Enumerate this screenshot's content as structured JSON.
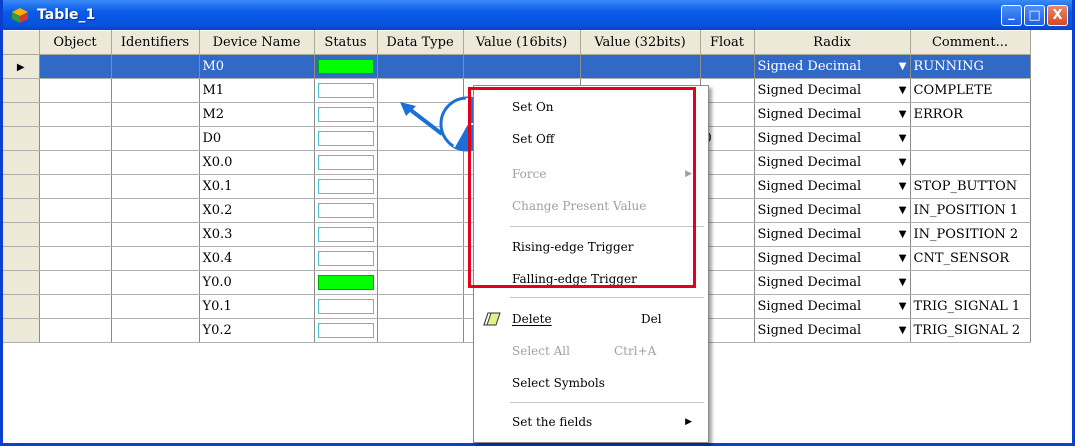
{
  "window": {
    "title": "Table_1",
    "minimize": "_",
    "maximize": "□",
    "close": "X"
  },
  "columns": [
    "Object",
    "Identifiers",
    "Device Name",
    "Status",
    "Data Type",
    "Value (16bits)",
    "Value (32bits)",
    "Float",
    "Radix",
    "Comment..."
  ],
  "rows": [
    {
      "device": "M0",
      "status_on": true,
      "float": "",
      "radix": "Signed Decimal",
      "comment": "RUNNING",
      "selected": true
    },
    {
      "device": "M1",
      "status_on": false,
      "float": "",
      "radix": "Signed Decimal",
      "comment": "COMPLETE"
    },
    {
      "device": "M2",
      "status_on": false,
      "float": "",
      "radix": "Signed Decimal",
      "comment": "ERROR"
    },
    {
      "device": "D0",
      "status_on": false,
      "float": "0",
      "radix": "Signed Decimal",
      "comment": ""
    },
    {
      "device": "X0.0",
      "status_on": false,
      "float": "",
      "radix": "Signed Decimal",
      "comment": ""
    },
    {
      "device": "X0.1",
      "status_on": false,
      "float": "",
      "radix": "Signed Decimal",
      "comment": "STOP_BUTTON"
    },
    {
      "device": "X0.2",
      "status_on": false,
      "float": "",
      "radix": "Signed Decimal",
      "comment": "IN_POSITION 1"
    },
    {
      "device": "X0.3",
      "status_on": false,
      "float": "",
      "radix": "Signed Decimal",
      "comment": "IN_POSITION 2"
    },
    {
      "device": "X0.4",
      "status_on": false,
      "float": "",
      "radix": "Signed Decimal",
      "comment": "CNT_SENSOR"
    },
    {
      "device": "Y0.0",
      "status_on": true,
      "float": "",
      "radix": "Signed Decimal",
      "comment": ""
    },
    {
      "device": "Y0.1",
      "status_on": false,
      "float": "",
      "radix": "Signed Decimal",
      "comment": "TRIG_SIGNAL 1"
    },
    {
      "device": "Y0.2",
      "status_on": false,
      "float": "",
      "radix": "Signed Decimal",
      "comment": "TRIG_SIGNAL 2"
    }
  ],
  "context_menu": {
    "set_on": "Set On",
    "set_off": "Set Off",
    "force": "Force",
    "change_present_value": "Change Present Value",
    "rising_edge": "Rising-edge Trigger",
    "falling_edge": "Falling-edge Trigger",
    "delete": "Delete",
    "delete_shortcut": "Del",
    "select_all": "Select All",
    "select_all_shortcut": "Ctrl+A",
    "select_symbols": "Select Symbols",
    "set_fields": "Set the fields"
  },
  "colors": {
    "status_on": "#00ff00",
    "selection": "#3169c6",
    "highlight_border": "#e3001a",
    "titlebar": "#0a5be8"
  }
}
